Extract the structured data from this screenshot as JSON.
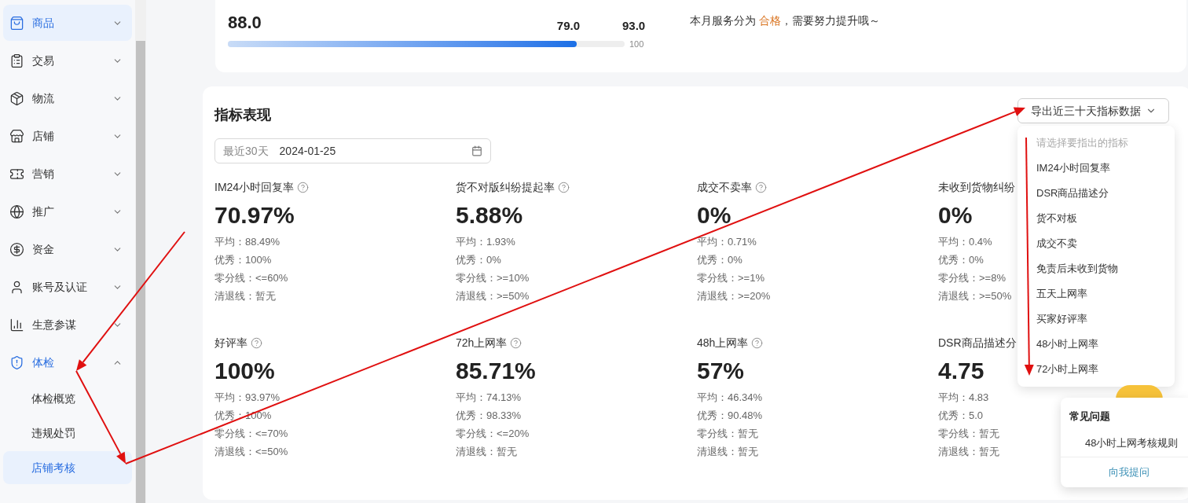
{
  "sidebar": {
    "items": [
      {
        "label": "商品",
        "selected": true,
        "expanded": false
      },
      {
        "label": "交易",
        "selected": false,
        "expanded": false
      },
      {
        "label": "物流",
        "selected": false,
        "expanded": false
      },
      {
        "label": "店铺",
        "selected": false,
        "expanded": false
      },
      {
        "label": "营销",
        "selected": false,
        "expanded": false
      },
      {
        "label": "推广",
        "selected": false,
        "expanded": false
      },
      {
        "label": "资金",
        "selected": false,
        "expanded": false
      },
      {
        "label": "账号及认证",
        "selected": false,
        "expanded": false
      },
      {
        "label": "生意参谋",
        "selected": false,
        "expanded": false
      },
      {
        "label": "体检",
        "selected": false,
        "expanded": true,
        "children": [
          {
            "label": "体检概览",
            "selected": false
          },
          {
            "label": "违规处罚",
            "selected": false
          },
          {
            "label": "店铺考核",
            "selected": true
          }
        ]
      }
    ]
  },
  "score_card": {
    "my_score": "88.0",
    "peer_average": "79.0",
    "peer_excellent": "93.0",
    "max": "100",
    "level": 0.88,
    "summary": {
      "prefix": "本月服务分为",
      "status": "合格",
      "suffix": "，需要努力提升哦～"
    }
  },
  "metrics_panel": {
    "title": "指标表现",
    "date_field": {
      "range": "最近30天",
      "value": "2024-01-25"
    },
    "export_button": "导出近三十天指标数据",
    "metrics": [
      {
        "title": "IM24小时回复率",
        "help": true,
        "value": "70.97%",
        "stats": [
          "平均：88.49%",
          "优秀：100%",
          "零分线：<=60%",
          "清退线：暂无"
        ]
      },
      {
        "title": "货不对版纠纷提起率",
        "help": true,
        "value": "5.88%",
        "stats": [
          "平均：1.93%",
          "优秀：0%",
          "零分线：>=10%",
          "清退线：>=50%"
        ]
      },
      {
        "title": "成交不卖率",
        "help": true,
        "value": "0%",
        "stats": [
          "平均：0.71%",
          "优秀：0%",
          "零分线：>=1%",
          "清退线：>=20%"
        ]
      },
      {
        "title": "未收到货物纠纷",
        "help": false,
        "value": "0%",
        "stats": [
          "平均：0.4%",
          "优秀：0%",
          "零分线：>=8%",
          "清退线：>=50%"
        ]
      },
      {
        "title": "好评率",
        "help": true,
        "value": "100%",
        "stats": [
          "平均：93.97%",
          "优秀：100%",
          "零分线：<=70%",
          "清退线：<=50%"
        ]
      },
      {
        "title": "72h上网率",
        "help": true,
        "value": "85.71%",
        "stats": [
          "平均：74.13%",
          "优秀：98.33%",
          "零分线：<=20%",
          "清退线：暂无"
        ]
      },
      {
        "title": "48h上网率",
        "help": true,
        "value": "57%",
        "stats": [
          "平均：46.34%",
          "优秀：90.48%",
          "零分线：暂无",
          "清退线：暂无"
        ]
      },
      {
        "title": "DSR商品描述分",
        "help": false,
        "value": "4.75",
        "stats": [
          "平均：4.83",
          "优秀：5.0",
          "零分线：暂无",
          "清退线：暂无"
        ]
      }
    ],
    "export_menu": {
      "hint": "请选择要指出的指标",
      "options": [
        "IM24小时回复率",
        "DSR商品描述分",
        "货不对板",
        "成交不卖",
        "免责后未收到货物",
        "五天上网率",
        "买家好评率",
        "48小时上网率",
        "72小时上网率"
      ]
    }
  },
  "help_panel": {
    "title": "常见问题",
    "questions": [
      "48小时上网考核规则"
    ],
    "ask_link": "向我提问"
  }
}
